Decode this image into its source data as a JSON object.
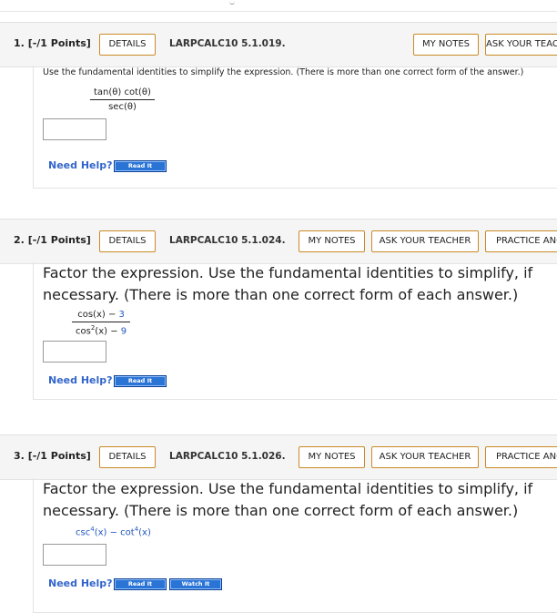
{
  "common": {
    "details": "DETAILS",
    "my_notes": "MY NOTES",
    "ask_teacher": "ASK YOUR TEACHER",
    "practice": "PRACTICE ANOTHER",
    "need_help": "Need Help?",
    "read_it": "Read It",
    "watch_it": "Watch It"
  },
  "questions": [
    {
      "number": "1.",
      "points": "[-/1 Points]",
      "code": "LARPCALC10 5.1.019.",
      "instruction": "Use the fundamental identities to simplify the expression. (There is more than one correct form of the answer.)",
      "numerator": "tan(θ) cot(θ)",
      "denominator": "sec(θ)"
    },
    {
      "number": "2.",
      "points": "[-/1 Points]",
      "code": "LARPCALC10 5.1.024.",
      "instruction": "Factor the expression. Use the fundamental identities to simplify, if necessary. (There is more than one correct form of each answer.)",
      "num_a": "cos(x) − ",
      "num_b": "3",
      "den_a": "cos",
      "den_exp": "2",
      "den_b": "(x) − ",
      "den_c": "9"
    },
    {
      "number": "3.",
      "points": "[-/1 Points]",
      "code": "LARPCALC10 5.1.026.",
      "instruction": "Factor the expression. Use the fundamental identities to simplify, if necessary. (There is more than one correct form of each answer.)",
      "e_a": "csc",
      "e_exp1": "4",
      "e_b": "(x) − cot",
      "e_exp2": "4",
      "e_c": "(x)"
    }
  ]
}
